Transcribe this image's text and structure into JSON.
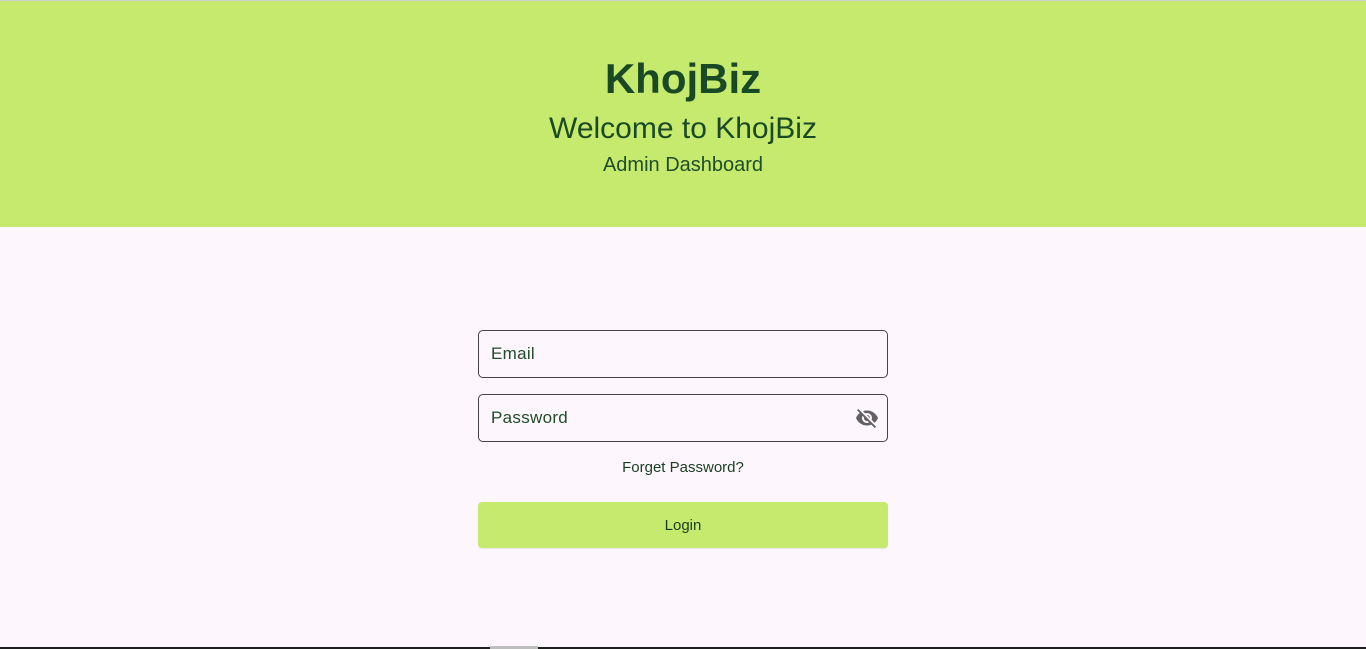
{
  "header": {
    "brand": "KhojBiz",
    "welcome": "Welcome to KhojBiz",
    "subtitle": "Admin Dashboard"
  },
  "login_form": {
    "email": {
      "placeholder": "Email",
      "value": ""
    },
    "password": {
      "placeholder": "Password",
      "value": "",
      "toggle_icon": "visibility-off-icon"
    },
    "forgot_label": "Forget Password?",
    "login_label": "Login"
  },
  "colors": {
    "header_background": "#c5ea6d",
    "page_background": "#fdf6fd",
    "text_dark_green": "#1a4a25",
    "button_background": "#c5ea6d"
  }
}
